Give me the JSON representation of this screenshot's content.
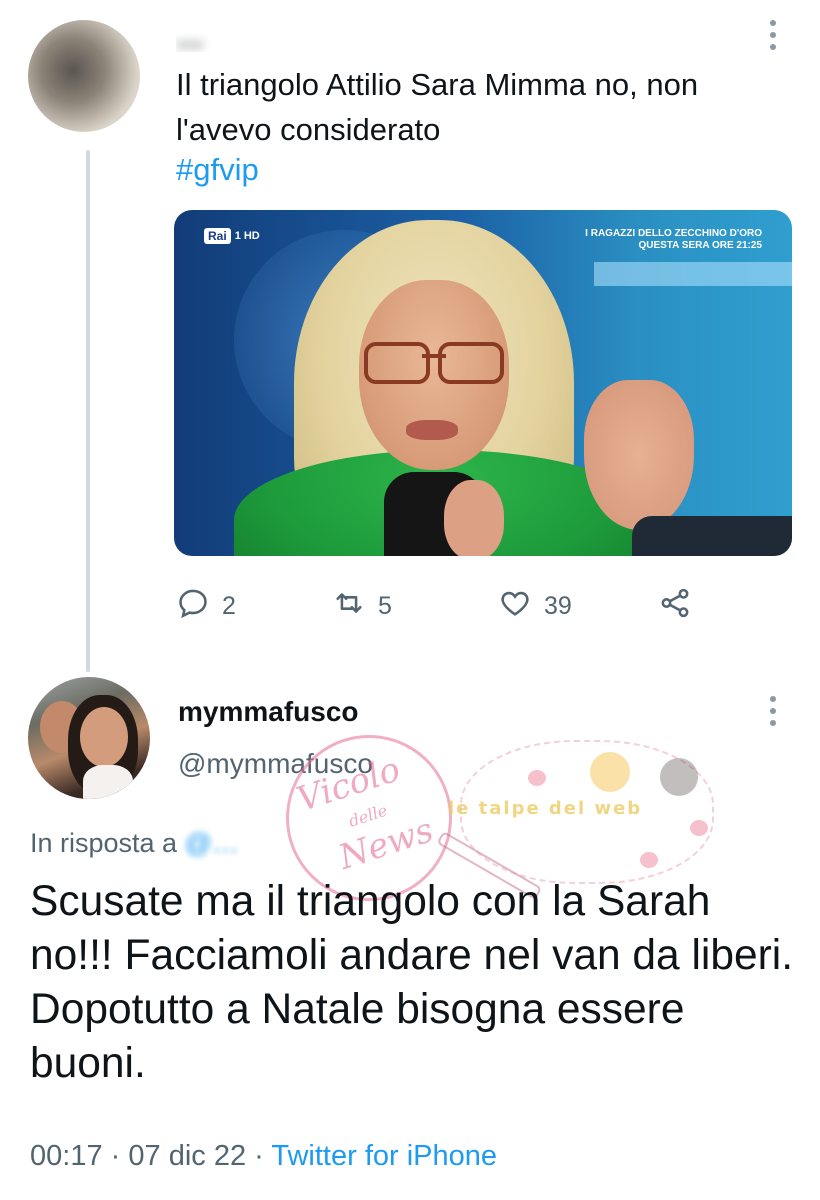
{
  "tweet1": {
    "author_name": "…",
    "text": "Il triangolo Attilio Sara Mimma no, non l'avevo considerato",
    "hashtag": "#gfvip",
    "media": {
      "channel_logo": "Rai",
      "channel_sub": "1 HD",
      "promo_line1": "I RAGAZZI DELLO ZECCHINO D'ORO",
      "promo_line2": "QUESTA SERA ORE 21:25"
    },
    "actions": {
      "replies": "2",
      "retweets": "5",
      "likes": "39"
    },
    "icons": [
      "reply-icon",
      "retweet-icon",
      "like-icon",
      "share-icon",
      "more-icon"
    ]
  },
  "tweet2": {
    "name": "mymmafusco",
    "handle": "@mymmafusco",
    "reply_prefix": "In risposta a",
    "reply_target": "@…",
    "text": "Scusate ma il triangolo con la Sarah no!!! Facciamoli andare nel van da liberi. Dopotutto a Natale bisogna essere buoni.",
    "time": "00:17",
    "date": "07 dic 22",
    "separator": "·",
    "source": "Twitter for iPhone"
  },
  "watermarks": {
    "stamp_line1": "Vicolo",
    "stamp_line2": "delle",
    "stamp_line3": "News",
    "band_text": "le talpe del web"
  },
  "colors": {
    "link": "#1d9bf0",
    "secondary_text": "#536471",
    "primary_text": "#0f1419",
    "thread_line": "#cfd9de"
  }
}
